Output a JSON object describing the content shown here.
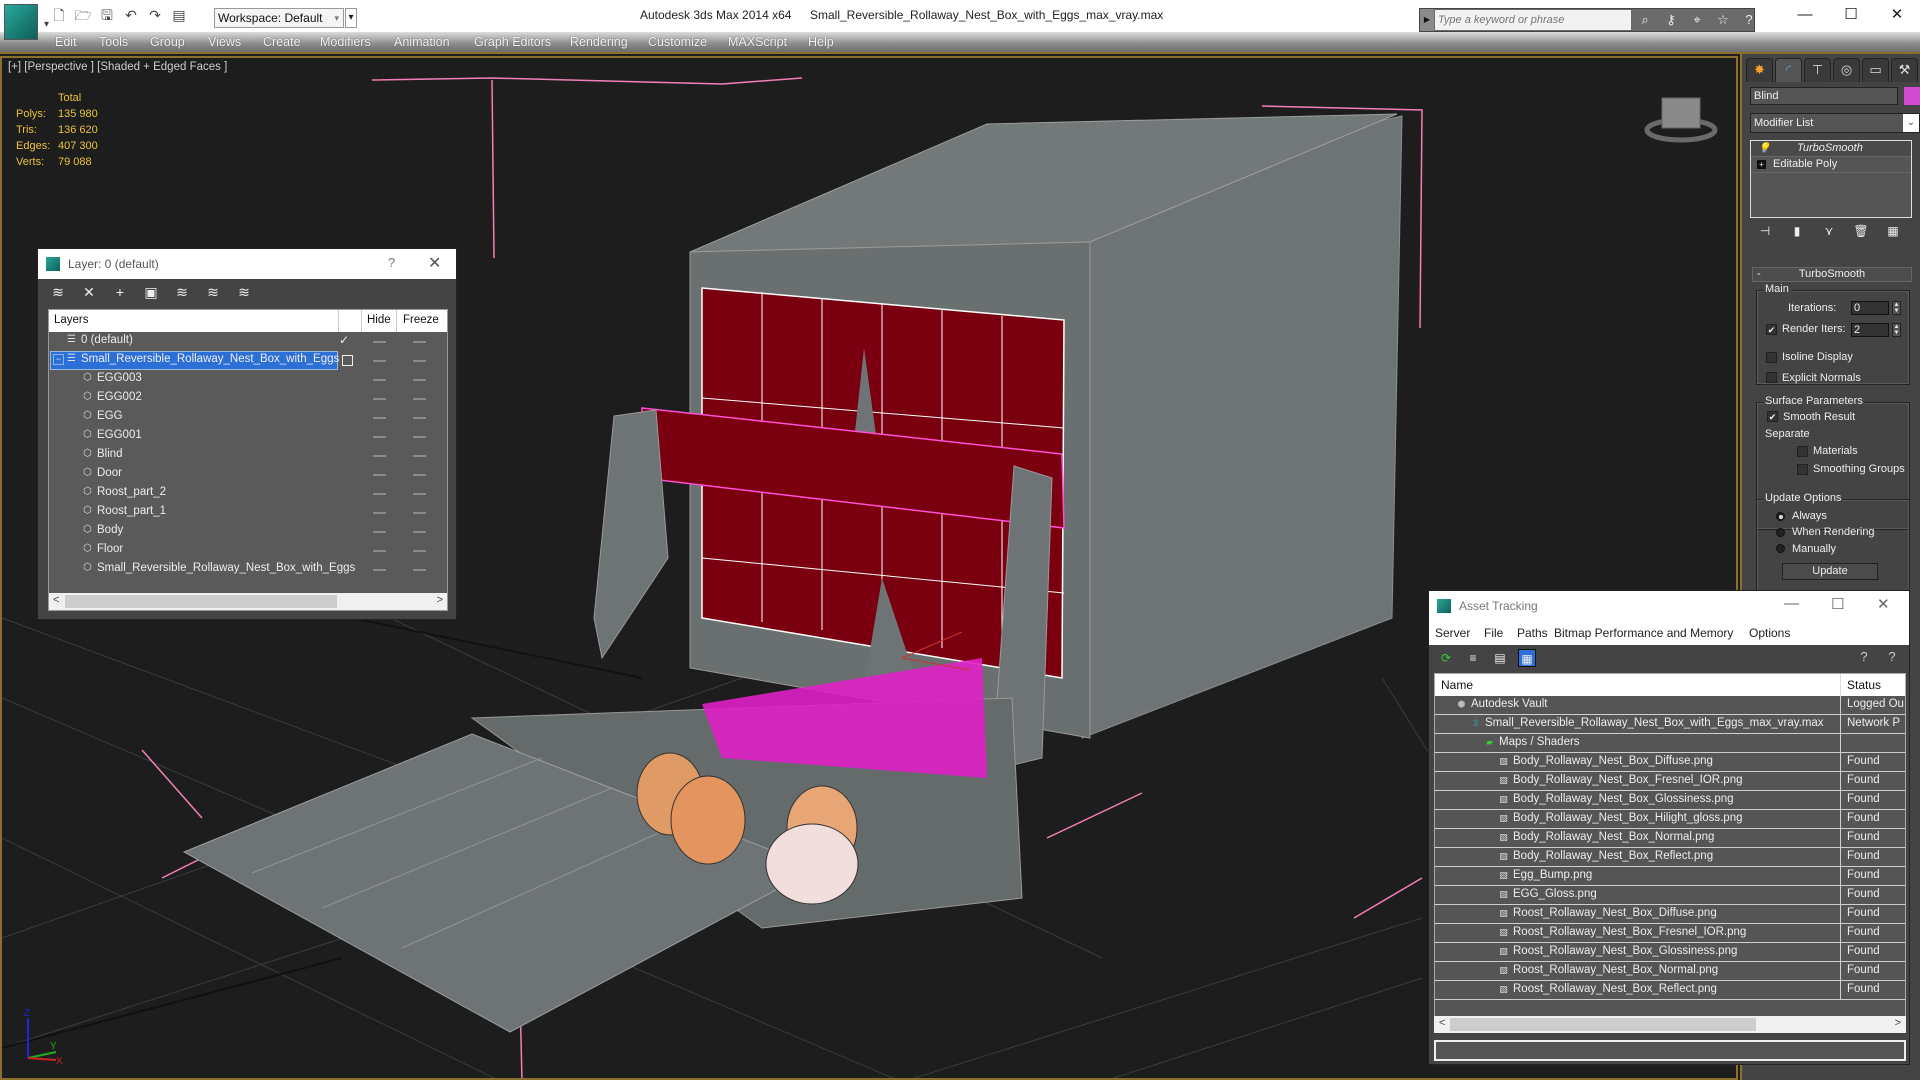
{
  "titlebar": {
    "app_title": "Autodesk 3ds Max  2014 x64",
    "file_title": "Small_Reversible_Rollaway_Nest_Box_with_Eggs_max_vray.max",
    "workspace": "Workspace: Default",
    "search_placeholder": "Type a keyword or phrase",
    "quick_access_icons": [
      "new-file-icon",
      "open-folder-icon",
      "save-icon",
      "undo-icon",
      "redo-icon",
      "project-folder-icon"
    ],
    "search_tools": [
      "binoculars-icon",
      "key-icon",
      "satellite-icon",
      "star-icon",
      "help-icon"
    ],
    "window_controls": {
      "minimize": "—",
      "maximize": "☐",
      "close": "✕"
    }
  },
  "menu": [
    "Edit",
    "Tools",
    "Group",
    "Views",
    "Create",
    "Modifiers",
    "Animation",
    "Graph Editors",
    "Rendering",
    "Customize",
    "MAXScript",
    "Help"
  ],
  "viewport": {
    "label": "[+] [Perspective ] [Shaded + Edged Faces ]",
    "stats": {
      "header": "Total",
      "rows": [
        {
          "key": "Polys:",
          "value": "135 980"
        },
        {
          "key": "Tris:",
          "value": "136 620"
        },
        {
          "key": "Edges:",
          "value": "407 300"
        },
        {
          "key": "Verts:",
          "value": "79 088"
        }
      ]
    },
    "colors": {
      "selected_blind": "#7a0010",
      "selection_wire": "#ff4fd8",
      "body_gray": "#6e7475",
      "egg_brown": "#e09a66",
      "egg_white": "#f3dede",
      "straw_magenta": "#e020c8"
    },
    "axis_labels": {
      "z": "Z",
      "y": "Y",
      "x": "X"
    }
  },
  "layer_dialog": {
    "title": "Layer: 0 (default)",
    "help": "?",
    "close": "✕",
    "toolbar_icons": [
      "create-layer-icon",
      "delete-layer-icon",
      "add-to-layer-icon",
      "select-objects-icon",
      "highlight-layer-icon",
      "current-layer-icon",
      "layer-settings-icon"
    ],
    "columns": {
      "layers": "Layers",
      "hide": "Hide",
      "freeze": "Freeze"
    },
    "rows": [
      {
        "name": "0 (default)",
        "level": 0,
        "type": "layer",
        "current": true
      },
      {
        "name": "Small_Reversible_Rollaway_Nest_Box_with_Eggs",
        "level": 0,
        "type": "layer",
        "selected": true,
        "expanded": true
      },
      {
        "name": "EGG003",
        "level": 1,
        "type": "object"
      },
      {
        "name": "EGG002",
        "level": 1,
        "type": "object"
      },
      {
        "name": "EGG",
        "level": 1,
        "type": "object"
      },
      {
        "name": "EGG001",
        "level": 1,
        "type": "object"
      },
      {
        "name": "Blind",
        "level": 1,
        "type": "object"
      },
      {
        "name": "Door",
        "level": 1,
        "type": "object"
      },
      {
        "name": "Roost_part_2",
        "level": 1,
        "type": "object"
      },
      {
        "name": "Roost_part_1",
        "level": 1,
        "type": "object"
      },
      {
        "name": "Body",
        "level": 1,
        "type": "object"
      },
      {
        "name": "Floor",
        "level": 1,
        "type": "object"
      },
      {
        "name": "Small_Reversible_Rollaway_Nest_Box_with_Eggs",
        "level": 1,
        "type": "object"
      }
    ]
  },
  "command_panel": {
    "tabs": [
      "create-icon",
      "modify-icon",
      "hierarchy-icon",
      "motion-icon",
      "display-icon",
      "utilities-icon"
    ],
    "object_name": "Blind",
    "object_color": "#d04bd0",
    "modifier_list": "Modifier List",
    "stack": [
      "TurboSmooth",
      "Editable Poly"
    ],
    "rollout_title": "TurboSmooth",
    "main_group": "Main",
    "iterations_label": "Iterations:",
    "iterations_value": "0",
    "render_iters_label": "Render Iters:",
    "render_iters_value": "2",
    "render_iters_checked": true,
    "isoline_display": "Isoline Display",
    "explicit_normals": "Explicit Normals",
    "surface_group": "Surface Parameters",
    "smooth_result": "Smooth Result",
    "separate": "Separate",
    "materials": "Materials",
    "smoothing_groups": "Smoothing Groups",
    "update_group": "Update Options",
    "update_options": [
      "Always",
      "When Rendering",
      "Manually"
    ],
    "update_selected": "Always",
    "update_button": "Update"
  },
  "asset_tracking": {
    "title": "Asset Tracking",
    "menu": [
      "Server",
      "File",
      "Paths",
      "Bitmap Performance and Memory",
      "Options"
    ],
    "columns": {
      "name": "Name",
      "status": "Status"
    },
    "rows": [
      {
        "name": "Autodesk Vault",
        "status": "Logged Ou",
        "level": 0,
        "icon": "vault-icon"
      },
      {
        "name": "Small_Reversible_Rollaway_Nest_Box_with_Eggs_max_vray.max",
        "status": "Network P",
        "level": 1,
        "icon": "max-file-icon"
      },
      {
        "name": "Maps / Shaders",
        "status": "",
        "level": 2,
        "icon": "maps-icon"
      },
      {
        "name": "Body_Rollaway_Nest_Box_Diffuse.png",
        "status": "Found",
        "level": 3,
        "icon": "bitmap-icon"
      },
      {
        "name": "Body_Rollaway_Nest_Box_Fresnel_IOR.png",
        "status": "Found",
        "level": 3,
        "icon": "bitmap-icon"
      },
      {
        "name": "Body_Rollaway_Nest_Box_Glossiness.png",
        "status": "Found",
        "level": 3,
        "icon": "bitmap-icon"
      },
      {
        "name": "Body_Rollaway_Nest_Box_Hilight_gloss.png",
        "status": "Found",
        "level": 3,
        "icon": "bitmap-icon"
      },
      {
        "name": "Body_Rollaway_Nest_Box_Normal.png",
        "status": "Found",
        "level": 3,
        "icon": "bitmap-icon"
      },
      {
        "name": "Body_Rollaway_Nest_Box_Reflect.png",
        "status": "Found",
        "level": 3,
        "icon": "bitmap-icon"
      },
      {
        "name": "Egg_Bump.png",
        "status": "Found",
        "level": 3,
        "icon": "bitmap-icon"
      },
      {
        "name": "EGG_Gloss.png",
        "status": "Found",
        "level": 3,
        "icon": "bitmap-icon"
      },
      {
        "name": "Roost_Rollaway_Nest_Box_Diffuse.png",
        "status": "Found",
        "level": 3,
        "icon": "bitmap-icon"
      },
      {
        "name": "Roost_Rollaway_Nest_Box_Fresnel_IOR.png",
        "status": "Found",
        "level": 3,
        "icon": "bitmap-icon"
      },
      {
        "name": "Roost_Rollaway_Nest_Box_Glossiness.png",
        "status": "Found",
        "level": 3,
        "icon": "bitmap-icon"
      },
      {
        "name": "Roost_Rollaway_Nest_Box_Normal.png",
        "status": "Found",
        "level": 3,
        "icon": "bitmap-icon"
      },
      {
        "name": "Roost_Rollaway_Nest_Box_Reflect.png",
        "status": "Found",
        "level": 3,
        "icon": "bitmap-icon"
      }
    ]
  }
}
